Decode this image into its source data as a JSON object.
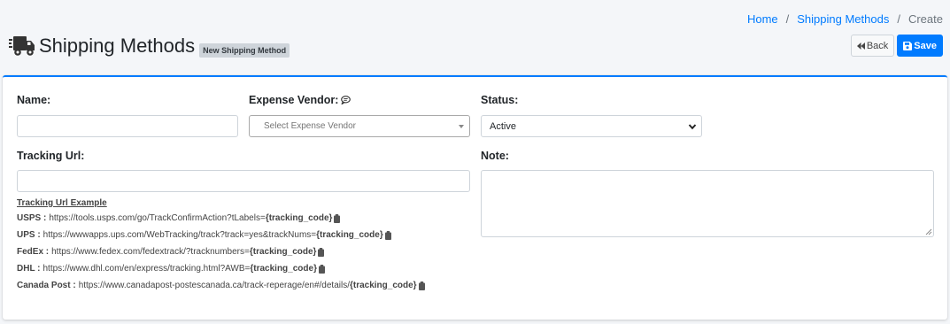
{
  "breadcrumb": {
    "home": "Home",
    "section": "Shipping Methods",
    "current": "Create",
    "separator": "/"
  },
  "header": {
    "title": "Shipping Methods",
    "badge": "New Shipping Method"
  },
  "actions": {
    "back_label": "Back",
    "save_label": "Save"
  },
  "form": {
    "name": {
      "label": "Name:",
      "value": ""
    },
    "expense_vendor": {
      "label": "Expense Vendor:",
      "placeholder": "Select Expense Vendor"
    },
    "status": {
      "label": "Status:",
      "value": "Active"
    },
    "tracking_url": {
      "label": "Tracking Url:",
      "value": ""
    },
    "note": {
      "label": "Note:",
      "value": ""
    }
  },
  "examples": {
    "heading": "Tracking Url Example",
    "items": [
      {
        "carrier": "USPS :",
        "url": "https://tools.usps.com/go/TrackConfirmAction?tLabels=",
        "code": "{tracking_code}"
      },
      {
        "carrier": "UPS :",
        "url": "https://wwwapps.ups.com/WebTracking/track?track=yes&trackNums=",
        "code": "{tracking_code}"
      },
      {
        "carrier": "FedEx :",
        "url": "https://www.fedex.com/fedextrack/?tracknumbers=",
        "code": "{tracking_code}"
      },
      {
        "carrier": "DHL :",
        "url": "https://www.dhl.com/en/express/tracking.html?AWB=",
        "code": "{tracking_code}"
      },
      {
        "carrier": "Canada Post :",
        "url": "https://www.canadapost-postescanada.ca/track-reperage/en#/details/",
        "code": "{tracking_code}"
      }
    ]
  },
  "colors": {
    "accent": "#007bff",
    "background": "#f4f6f9",
    "badge": "#ced4da"
  }
}
